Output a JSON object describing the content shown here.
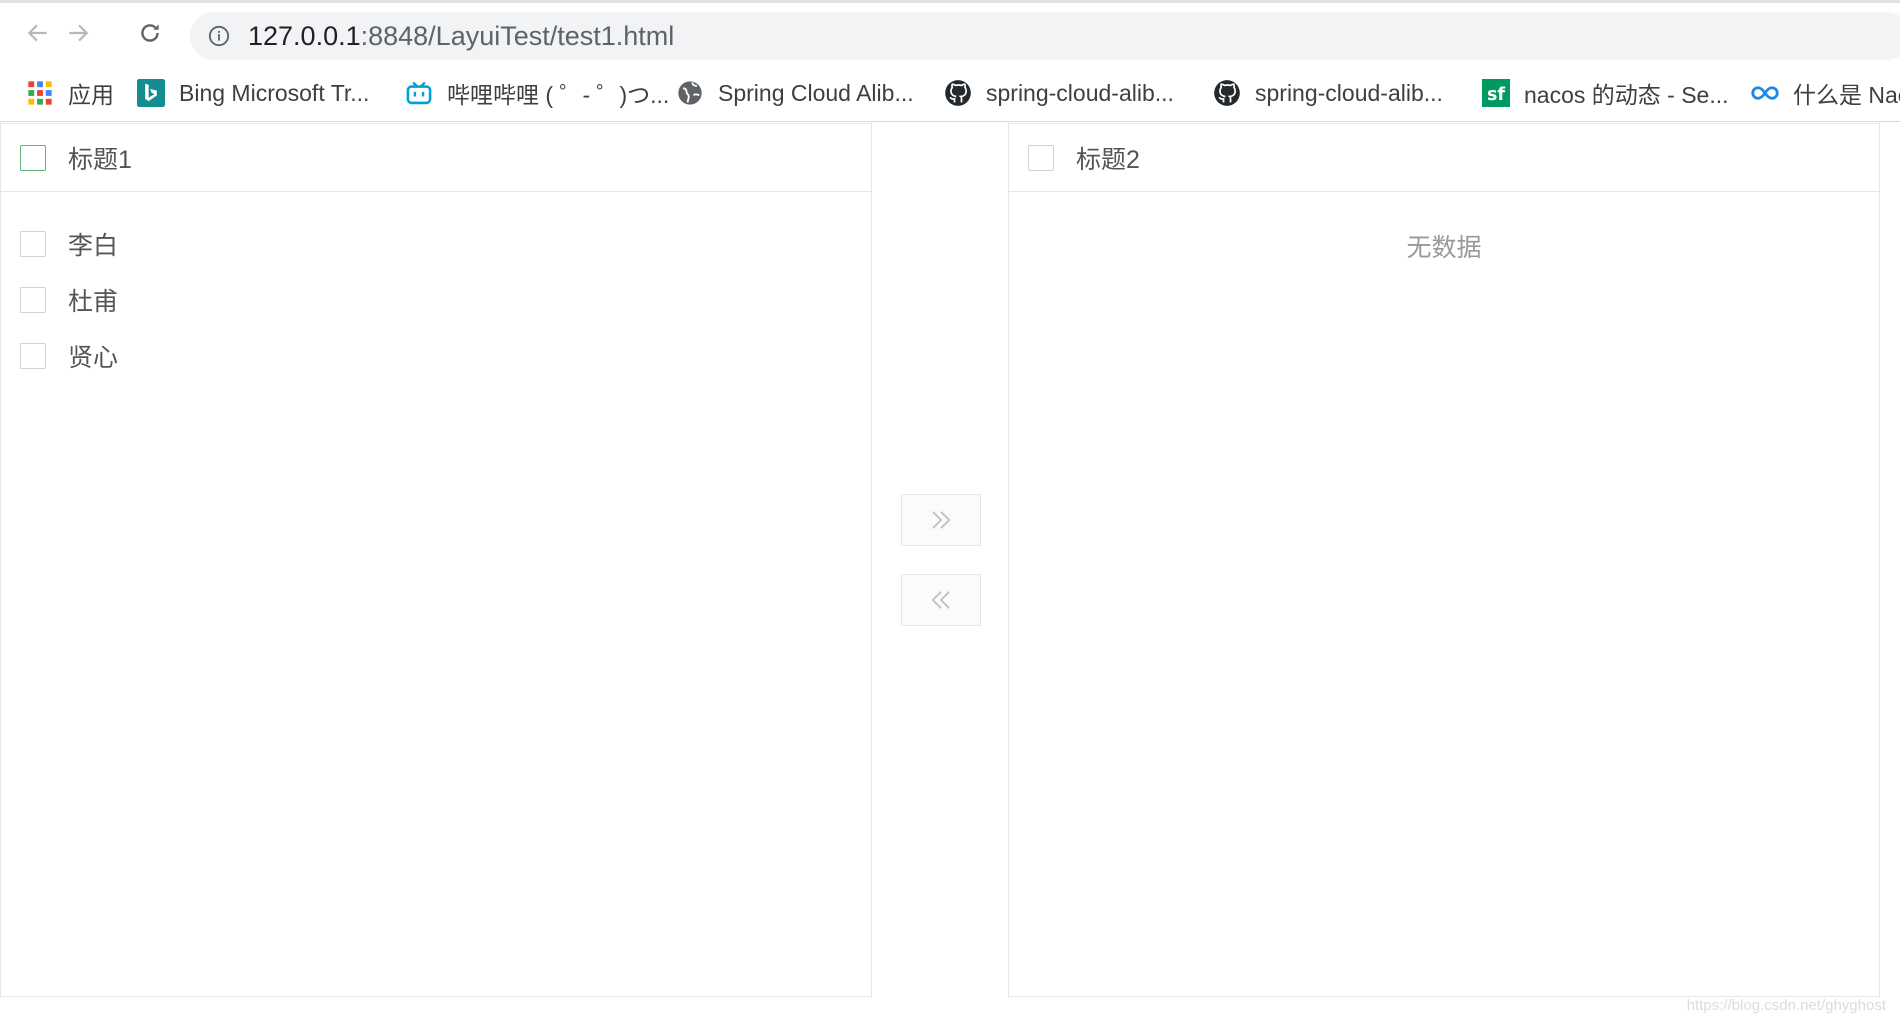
{
  "browser": {
    "url_host": "127.0.0.1",
    "url_path": ":8848/LayuiTest/test1.html"
  },
  "bookmarks": [
    {
      "label": "应用",
      "icon": "apps-grid-icon"
    },
    {
      "label": "Bing Microsoft Tr...",
      "icon": "bing-icon"
    },
    {
      "label": "哔哩哔哩 ( ゜- ゜)つ...",
      "icon": "bilibili-icon"
    },
    {
      "label": "Spring Cloud Alib...",
      "icon": "globe-icon"
    },
    {
      "label": "spring-cloud-alib...",
      "icon": "github-icon"
    },
    {
      "label": "spring-cloud-alib...",
      "icon": "github-icon"
    },
    {
      "label": "nacos 的动态 - Se...",
      "icon": "segmentfault-icon"
    },
    {
      "label": "什么是 Nac",
      "icon": "infinity-icon"
    }
  ],
  "transfer": {
    "left": {
      "title": "标题1",
      "items": [
        {
          "label": "李白",
          "checked": false
        },
        {
          "label": "杜甫",
          "checked": false
        },
        {
          "label": "贤心",
          "checked": false
        }
      ]
    },
    "right": {
      "title": "标题2",
      "empty_text": "无数据"
    },
    "buttons": {
      "to_right_icon": "double-chevron-right-icon",
      "to_left_icon": "double-chevron-left-icon"
    }
  },
  "watermark": "https://blog.csdn.net/ghyghost",
  "colors": {
    "checkbox_focus_border": "#5fb878",
    "border": "#e6e6e6",
    "empty_text": "#999999"
  }
}
